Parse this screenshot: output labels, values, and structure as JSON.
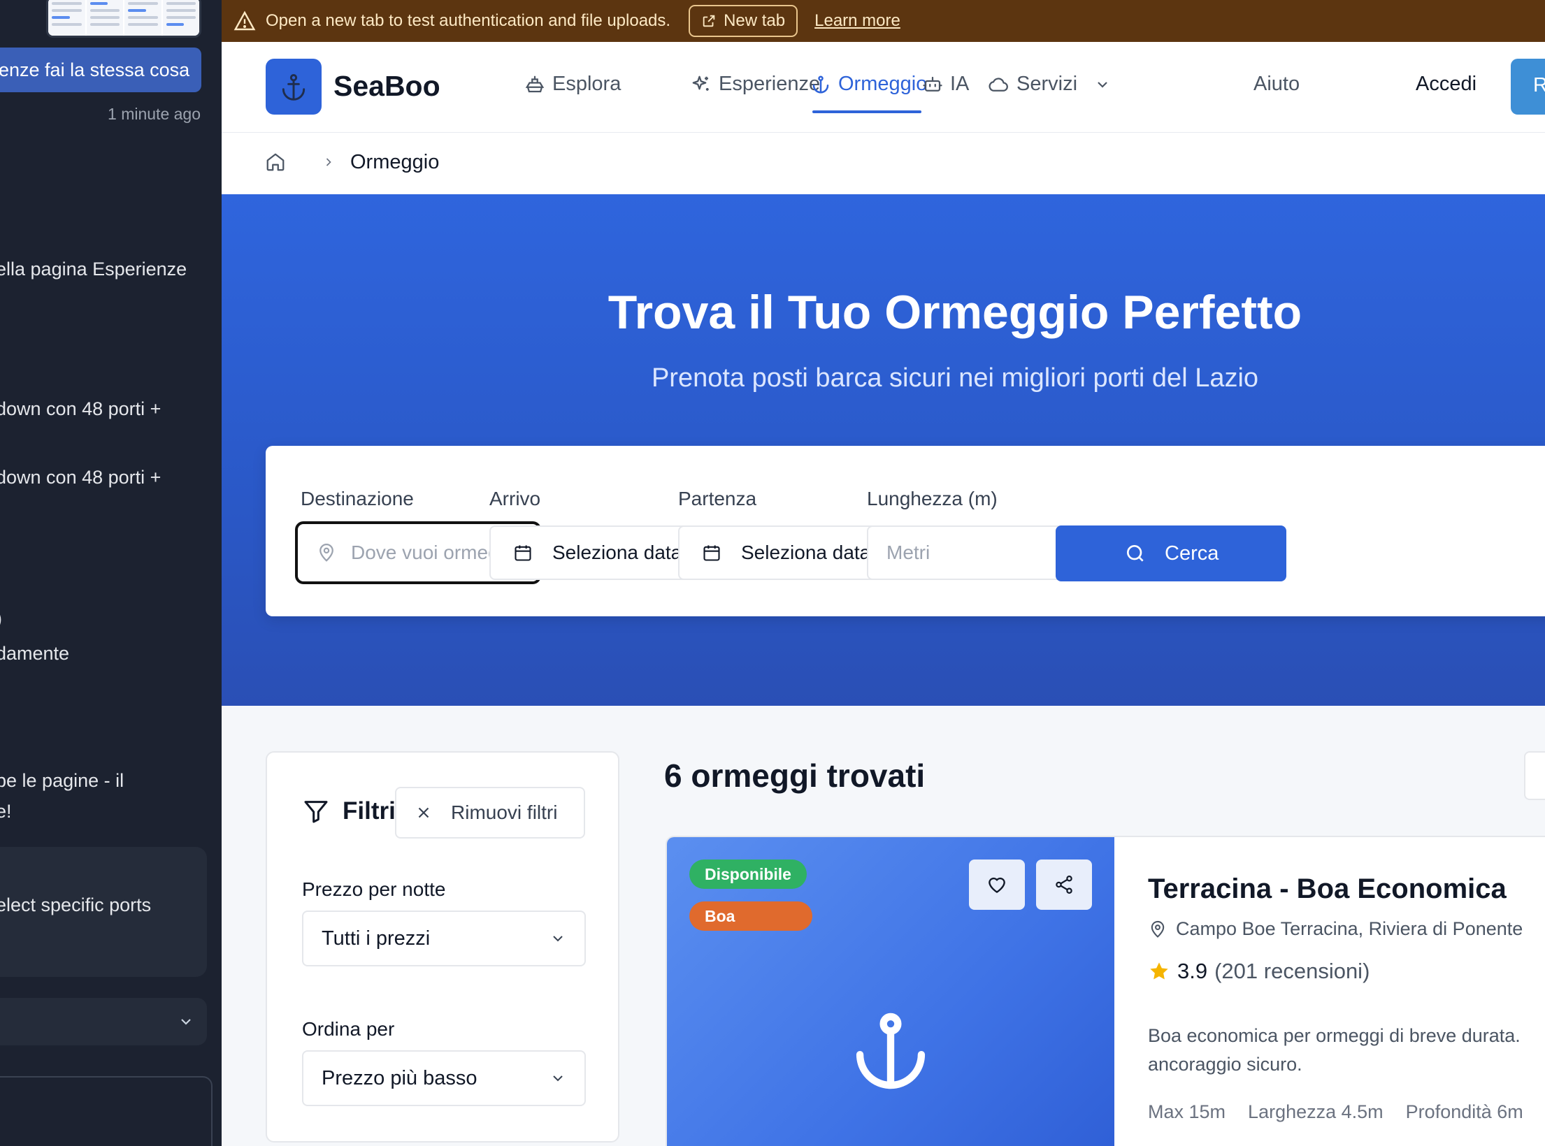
{
  "sidebar": {
    "active_message": "enze fai la stessa cosa",
    "timestamp": "1 minute ago",
    "lines": [
      "ella pagina Esperienze",
      "down con 48 porti +",
      "down con 48 porti +",
      ")",
      "damente",
      "be le pagine - il",
      "e!",
      "elect specific ports"
    ]
  },
  "banner": {
    "message": "Open a new tab to test authentication and file uploads.",
    "new_tab_label": "New tab",
    "learn_more": "Learn more"
  },
  "nav": {
    "brand": "SeaBoo",
    "items": [
      {
        "label": "Esplora",
        "icon": "ship-icon"
      },
      {
        "label": "Esperienze",
        "icon": "sparkles-icon"
      },
      {
        "label": "Ormeggio",
        "icon": "anchor-icon",
        "active": true
      },
      {
        "label": "IA",
        "icon": "bot-icon"
      },
      {
        "label": "Servizi",
        "icon": "cloud-icon"
      },
      {
        "label": "Aiuto"
      }
    ],
    "login": "Accedi",
    "register_partial": "R"
  },
  "breadcrumb": {
    "current": "Ormeggio"
  },
  "hero": {
    "title": "Trova il Tuo Ormeggio Perfetto",
    "subtitle": "Prenota posti barca sicuri nei migliori porti del Lazio"
  },
  "search": {
    "destination_label": "Destinazione",
    "destination_placeholder": "Dove vuoi ormeggi",
    "arrival_label": "Arrivo",
    "arrival_value": "Seleziona data",
    "departure_label": "Partenza",
    "departure_value": "Seleziona data",
    "length_label": "Lunghezza (m)",
    "length_placeholder": "Metri",
    "submit": "Cerca"
  },
  "filters": {
    "title": "Filtri",
    "clear": "Rimuovi filtri",
    "price_label": "Prezzo per notte",
    "price_value": "Tutti i prezzi",
    "sort_label": "Ordina per",
    "sort_value": "Prezzo più basso"
  },
  "results": {
    "count_text": "6 ormeggi trovati",
    "listings": [
      {
        "status": "Disponibile",
        "type": "Boa",
        "title": "Terracina - Boa Economica",
        "location": "Campo Boe Terracina, Riviera di Ponente",
        "rating": "3.9",
        "reviews": "(201 recensioni)",
        "description": "Boa economica per ormeggi di breve durata. ancoraggio sicuro.",
        "specs": [
          "Max 15m",
          "Larghezza 4.5m",
          "Profondità 6m"
        ]
      }
    ]
  },
  "colors": {
    "primary": "#2e63d9",
    "banner_bg": "#5c3510",
    "sidebar_bg": "#1c2230",
    "available": "#2fb163",
    "type_badge": "#e06a2d",
    "star": "#f5b400"
  }
}
